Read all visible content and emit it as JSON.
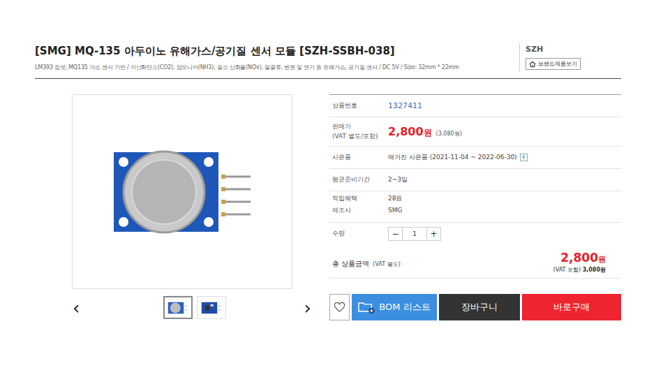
{
  "product": {
    "title": "[SMG] MQ-135 아두이노 유해가스/공기질 센서 모듈 [SZH-SSBH-038]",
    "subtitle": "LM393 칩셋, MQ135 가스 센서 기반 / 이산화탄소(CO2), 암모니아(NH3), 질소 산화물(NOx), 알콜류, 벤젠 및 연기 등 유해가스, 공기질 센서 / DC 5V / Size: 32mm * 22mm"
  },
  "brand": {
    "name": "SZH",
    "button": "브랜드제품보기"
  },
  "gallery": {
    "prev": "‹",
    "next": "›",
    "thumbnails": [
      {
        "selected": true
      },
      {
        "selected": false
      }
    ]
  },
  "info": {
    "product_number": {
      "label": "상품번호",
      "value": "1327411"
    },
    "price": {
      "label": "판매가",
      "note": "(VAT 별도/포함)",
      "value": "2,800",
      "unit": "원",
      "vat": "(3,080원)"
    },
    "gift": {
      "label": "사은품",
      "value": "매거진 사은품 (2021-11-04 ~ 2022-06-30)",
      "help": "?"
    },
    "prep": {
      "label": "평균준비기간",
      "value": "2~3일"
    },
    "points": {
      "label": "적립혜택",
      "value": "28원"
    },
    "maker": {
      "label": "제조사",
      "value": "SMG"
    },
    "quantity": {
      "label": "수량",
      "minus": "−",
      "value": "1",
      "plus": "+"
    }
  },
  "total": {
    "label": "총 상품금액",
    "note": "(VAT 별도)",
    "value": "2,800",
    "unit": "원",
    "vat_label": "(VAT 포함)",
    "vat_value": "3,080원"
  },
  "buttons": {
    "bom": "BOM 리스트",
    "cart": "장바구니",
    "buy": "바로구매"
  }
}
